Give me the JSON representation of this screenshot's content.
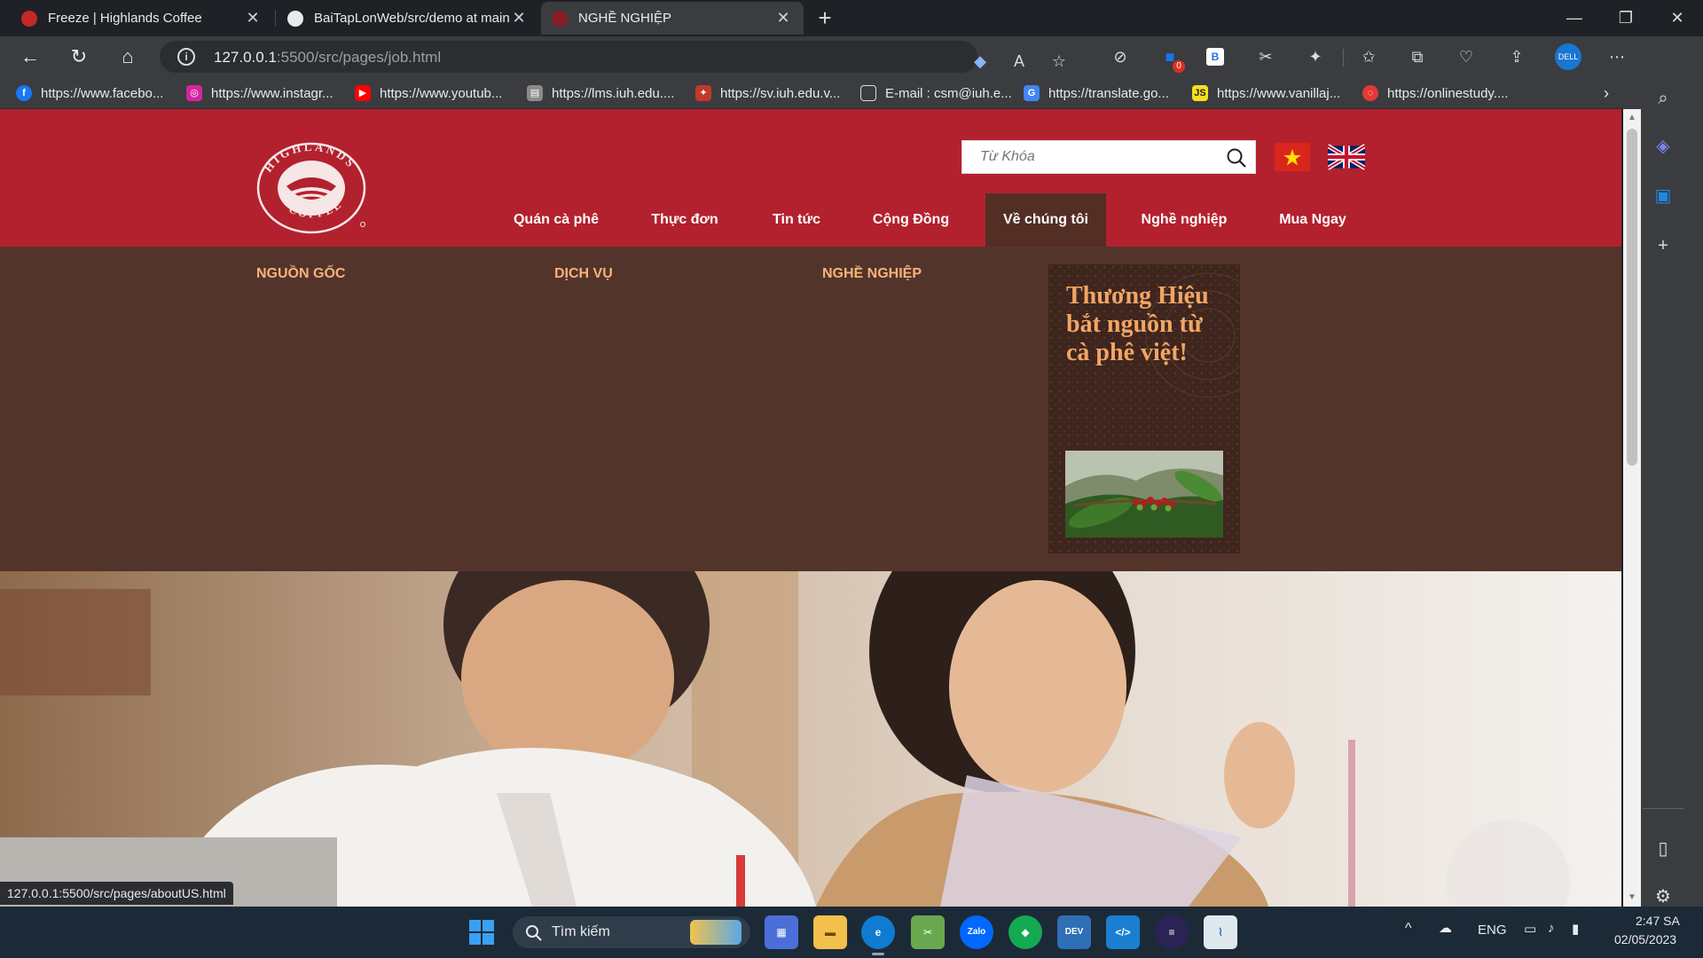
{
  "browser": {
    "tabs": [
      {
        "title": "Freeze | Highlands Coffee",
        "active": false
      },
      {
        "title": "BaiTapLonWeb/src/demo at main",
        "active": false
      },
      {
        "title": "NGHỀ NGHIỆP",
        "active": true
      }
    ],
    "url_host": "127.0.0.1",
    "url_rest": ":5500/src/pages/job.html",
    "bookmarks": [
      {
        "label": "https://www.facebo...",
        "icon": "facebook-icon",
        "color": "#1877f2"
      },
      {
        "label": "https://www.instagr...",
        "icon": "instagram-icon",
        "color": "#d6249f"
      },
      {
        "label": "https://www.youtub...",
        "icon": "youtube-icon",
        "color": "#ff0000"
      },
      {
        "label": "https://lms.iuh.edu....",
        "icon": "lms-icon",
        "color": "#8a8a8a"
      },
      {
        "label": "https://sv.iuh.edu.v...",
        "icon": "iuh-icon",
        "color": "#c0392b"
      },
      {
        "label": "E-mail : csm@iuh.e...",
        "icon": "document-icon",
        "color": "#3a3c40"
      },
      {
        "label": "https://translate.go...",
        "icon": "translate-icon",
        "color": "#4285f4"
      },
      {
        "label": "https://www.vanillaj...",
        "icon": "js-icon",
        "color": "#f7df1e"
      },
      {
        "label": "https://onlinestudy....",
        "icon": "onlinestudy-icon",
        "color": "#e53935"
      }
    ],
    "extension_badge": "0",
    "status_url": "127.0.0.1:5500/src/pages/aboutUS.html"
  },
  "site": {
    "brand_color": "#b3212e",
    "search_placeholder": "Từ Khóa",
    "nav": [
      {
        "label": "Quán cà phê"
      },
      {
        "label": "Thực đơn"
      },
      {
        "label": "Tin tức"
      },
      {
        "label": "Cộng Đồng"
      },
      {
        "label": "Về chúng tôi",
        "active": true
      },
      {
        "label": "Nghề nghiệp"
      },
      {
        "label": "Mua Ngay"
      }
    ],
    "megamenu": {
      "columns": [
        "NGUỒN GỐC",
        "DỊCH VỤ",
        "NGHỀ NGHIỆP"
      ],
      "promo_text": "Thương Hiệu bắt nguồn từ cà phê việt!"
    }
  },
  "taskbar": {
    "search_label": "Tìm kiếm",
    "language": "ENG",
    "time": "2:47 SA",
    "date": "02/05/2023",
    "apps": [
      "windows-start-icon",
      "store-icon",
      "file-explorer-icon",
      "edge-icon",
      "snip-icon",
      "zalo-icon",
      "mongodb-icon",
      "devc-icon",
      "vscode-icon",
      "eclipse-icon",
      "matlab-icon"
    ]
  }
}
